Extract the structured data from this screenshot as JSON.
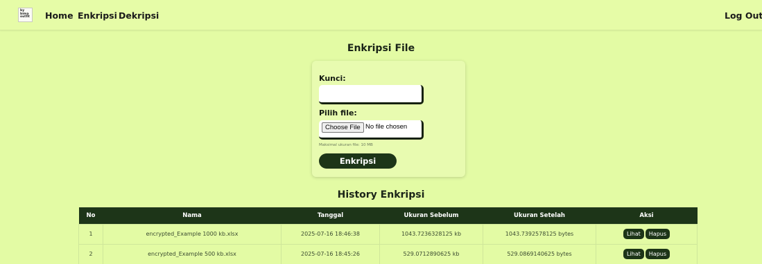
{
  "nav": {
    "logo_text": "by bima outfit",
    "links": [
      "Home",
      "Enkripsi",
      "Dekripsi"
    ],
    "logout": "Log Out"
  },
  "form": {
    "title": "Enkripsi File",
    "key_label": "Kunci:",
    "key_value": "",
    "file_label": "Pilih file:",
    "file_button": "Choose File",
    "file_status": "No file chosen",
    "hint": "Maksimal ukuran file: 10 MB",
    "submit_label": "Enkripsi"
  },
  "history": {
    "title": "History Enkripsi",
    "columns": [
      "No",
      "Nama",
      "Tanggal",
      "Ukuran Sebelum",
      "Ukuran Setelah",
      "Aksi"
    ],
    "rows": [
      {
        "no": "1",
        "nama": "encrypted_Example 1000 kb.xlsx",
        "tanggal": "2025-07-16 18:46:38",
        "sebelum": "1043.7236328125 kb",
        "setelah": "1043.7392578125 bytes"
      },
      {
        "no": "2",
        "nama": "encrypted_Example 500 kb.xlsx",
        "tanggal": "2025-07-16 18:45:26",
        "sebelum": "529.0712890625 kb",
        "setelah": "529.0869140625 bytes"
      }
    ],
    "action_view": "Lihat",
    "action_delete": "Hapus"
  }
}
